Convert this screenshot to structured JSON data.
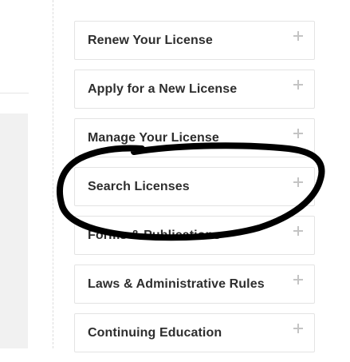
{
  "accordion": {
    "items": [
      {
        "label": "Renew Your License",
        "icon": "plus-icon"
      },
      {
        "label": "Apply for a New License",
        "icon": "plus-icon"
      },
      {
        "label": "Manage Your License",
        "icon": "plus-icon"
      },
      {
        "label": "Search Licenses",
        "icon": "plus-icon"
      },
      {
        "label": "Forms & Publications",
        "icon": "plus-icon"
      },
      {
        "label": "Laws & Administrative Rules",
        "icon": "plus-icon"
      },
      {
        "label": "Continuing Education",
        "icon": "plus-icon"
      }
    ]
  },
  "annotation": {
    "shape": "hand-drawn-ellipse",
    "color": "#000000",
    "circled_item": "Search Licenses"
  }
}
